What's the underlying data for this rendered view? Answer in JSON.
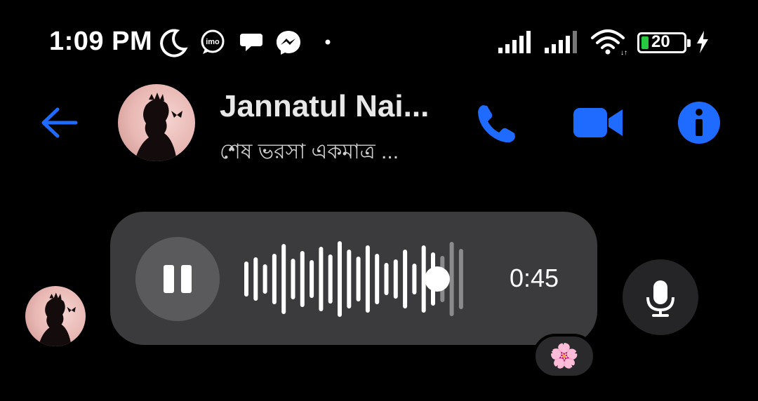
{
  "status_bar": {
    "time": "1:09 PM",
    "battery_level": "20",
    "icons": [
      "moon-icon",
      "imo-icon",
      "chat-bubble-icon",
      "messenger-icon",
      "dot-icon",
      "signal-icon",
      "signal-icon",
      "wifi-icon",
      "battery-icon",
      "charging-icon"
    ]
  },
  "header": {
    "contact_name": "Jannatul Nai...",
    "contact_status": "শেষ ভরসা একমাত্র ...",
    "actions": [
      "back-arrow-icon",
      "phone-icon",
      "video-camera-icon",
      "info-icon"
    ]
  },
  "message": {
    "voice_duration": "0:45",
    "playback_progress": 0.88,
    "reaction": "🌸"
  },
  "colors": {
    "accent": "#1f6bff",
    "bubble": "#3b3b3e",
    "background": "#000000",
    "battery": "#27c93f"
  }
}
